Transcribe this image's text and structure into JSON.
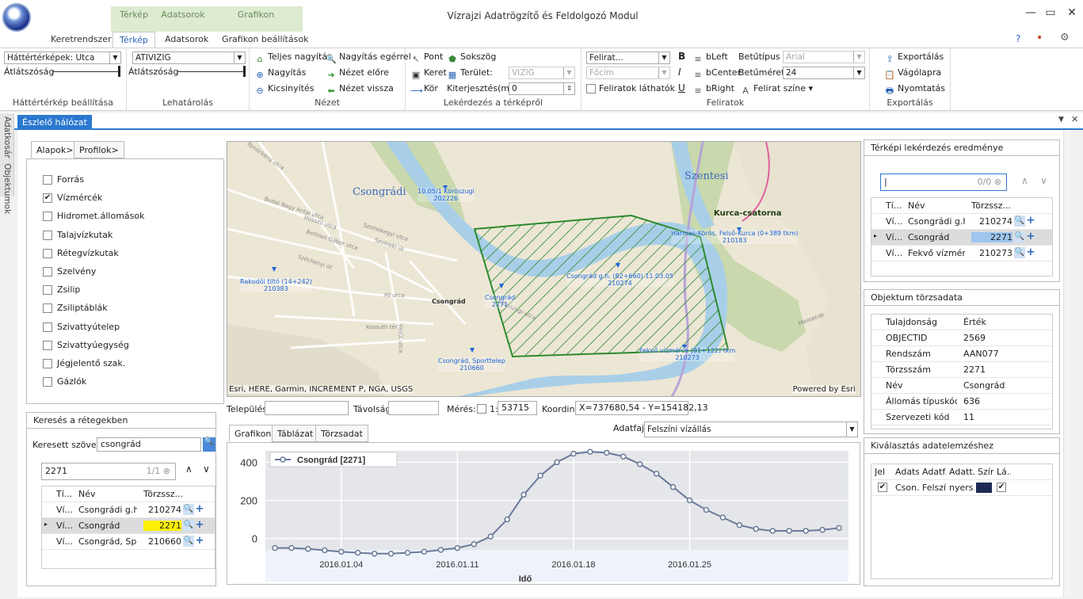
{
  "app": {
    "title": "Vízrajzi Adatrögzítő és Feldolgozó Modul",
    "context_tabs": [
      "Térkép",
      "Adatsorok",
      "Grafikon"
    ],
    "tabs": [
      "Keretrendszer",
      "Térkép",
      "Adatsorok",
      "Grafikon beállítások"
    ],
    "active_tab": "Térkép"
  },
  "window": {
    "minimize": "—",
    "maximize": "▭",
    "close": "✕",
    "help": "?",
    "user": "•",
    "settings": "⚙"
  },
  "ribbon": {
    "basemap": {
      "combo": "Háttértérképek: Utca",
      "opacity_label": "Átlátszóság",
      "group": "Háttértérkép beállítása"
    },
    "access": {
      "combo": "ATIVIZIG",
      "opacity_label": "Átlátszóság",
      "group": "Lehatárolás"
    },
    "view": {
      "full": "Teljes nagyítás",
      "zoom_mouse": "Nagyítás egérrel",
      "zoom_in": "Nagyítás",
      "prev": "Nézet előre",
      "zoom_out": "Kicsinyítés",
      "back": "Nézet vissza",
      "group": "Nézet"
    },
    "query": {
      "point": "Pont",
      "polygon": "Sokszög",
      "frame": "Keret",
      "area": "Terület:",
      "area_combo": "VIZIG",
      "circle": "Kör",
      "extent_label": "Kiterjesztés(m):",
      "extent_value": "0",
      "group": "Lekérdezés a térképről"
    },
    "labels": {
      "combo1": "Felirat...",
      "combo2": "Főcím",
      "visible": "Feliratok láthatók",
      "bleft": "bLeft",
      "bcenter": "bCenter",
      "bright": "bRight",
      "font_label": "Betűtípus",
      "font_value": "Arial",
      "size_label": "Betűméret",
      "size_value": "24",
      "color_label": "Felirat színe",
      "bold": "B",
      "italic": "I",
      "underline": "U",
      "group": "Feliratok"
    },
    "export": {
      "export": "Exportálás",
      "clipboard": "Vágólapra",
      "print": "Nyomtatás",
      "group": "Exportálás"
    }
  },
  "sidebar": {
    "items": [
      "Adatkosár",
      "Objektumok"
    ]
  },
  "doc_tab": "Észlelő hálózat",
  "left_panel": {
    "tabs": [
      "Alapok>",
      "Profilok>"
    ],
    "layers": [
      {
        "label": "Forrás",
        "checked": false
      },
      {
        "label": "Vízmércék",
        "checked": true
      },
      {
        "label": "Hidromet.állomások",
        "checked": false
      },
      {
        "label": "Talajvízkutak",
        "checked": false
      },
      {
        "label": "Rétegvízkutak",
        "checked": false
      },
      {
        "label": "Szelvény",
        "checked": false
      },
      {
        "label": "Zsilip",
        "checked": false
      },
      {
        "label": "Zsiliptáblák",
        "checked": false
      },
      {
        "label": "Szivattyútelep",
        "checked": false
      },
      {
        "label": "Szivattyúegység",
        "checked": false
      },
      {
        "label": "Jégjelentő szak.",
        "checked": false
      },
      {
        "label": "Gázlók",
        "checked": false
      }
    ]
  },
  "search": {
    "title": "Keresés a rétegekben",
    "label": "Keresett szöveg:",
    "value": "csongrád",
    "filter": "2271",
    "count": "1/1",
    "columns": [
      "Tí...",
      "Név",
      "Törzssz..."
    ],
    "rows": [
      {
        "type": "Ví...",
        "name": "Csongrádi g.h...",
        "id": "210274"
      },
      {
        "type": "Ví...",
        "name": "Csongrád",
        "id": "2271"
      },
      {
        "type": "Ví...",
        "name": "Csongrád, Sp...",
        "id": "210660"
      }
    ]
  },
  "map": {
    "attribution": "Esri, HERE, Garmin, INCREMENT P, NGA, USGS",
    "powered": "Powered by Esri",
    "place_labels": [
      "Csongrádi",
      "Szentesi",
      "Kurca-csatorna",
      "Csongrád"
    ],
    "stations": [
      {
        "text": "10.05/1 Köröszugi\n202226"
      },
      {
        "text": "Hármas-Körös, Felső-Kurca (0+389 tkm)\n210183"
      },
      {
        "text": "Rakodói tiltó (14+242)\n210383"
      },
      {
        "text": "Csongrád g.h. (82+660) 11.03.05\n210274"
      },
      {
        "text": "Csongrád\n2271"
      },
      {
        "text": "Csongrád, Sporttelep\n210660"
      },
      {
        "text": "Fekvő vízmérce (81+122) tkm\n210273"
      }
    ],
    "streets": [
      "Tömörkény utca",
      "Budai Nagy Antal utca",
      "Hosszú utca",
      "Bethlen Gábor utca",
      "Szolnoki út",
      "Szolnokegyi utca",
      "Fő utca",
      "Széchenyi út",
      "Köröszugi utca",
      "Kossuth tér",
      "Vasút utca",
      "Mentetrét"
    ]
  },
  "map_toolbar": {
    "settlement_label": "Település:",
    "distance_label": "Távolság:",
    "scale_label": "Mérés:",
    "scale_prefix": "1:",
    "scale_value": "53715",
    "coord_label": "Koordináták",
    "coord_value": "X=737680,54 - Y=154182,13"
  },
  "chart_panel": {
    "tabs": [
      "Grafikon",
      "Táblázat",
      "Törzsadat"
    ],
    "data_type_label": "Adatfajta",
    "data_type_value": "Felszíni vízállás"
  },
  "chart_data": {
    "type": "line",
    "xlabel": "Idő",
    "ylabel": "",
    "ylim": [
      -60,
      460
    ],
    "y_ticks": [
      0,
      200,
      400
    ],
    "x_ticks": [
      "2016.01.04",
      "2016.01.11",
      "2016.01.18",
      "2016.01.25"
    ],
    "series": [
      {
        "name": "Csongrád [2271]",
        "color": "#6a7a98",
        "values": [
          -50,
          -50,
          -55,
          -62,
          -70,
          -75,
          -80,
          -80,
          -75,
          -70,
          -60,
          -50,
          -30,
          10,
          100,
          230,
          330,
          400,
          445,
          455,
          450,
          430,
          390,
          340,
          270,
          200,
          150,
          110,
          70,
          50,
          40,
          40,
          40,
          45,
          55
        ]
      }
    ]
  },
  "query_results": {
    "title": "Térképi lekérdezés eredménye",
    "count": "0/0",
    "columns": [
      "Tí...",
      "Név",
      "Törzssz..."
    ],
    "rows": [
      {
        "type": "Ví...",
        "name": "Csongrádi g.h...",
        "id": "210274"
      },
      {
        "type": "Ví...",
        "name": "Csongrád",
        "id": "2271"
      },
      {
        "type": "Ví...",
        "name": "Fekvő vízmérc...",
        "id": "210273"
      }
    ]
  },
  "master_data": {
    "title": "Objektum törzsadata",
    "columns": [
      "Tulajdonság",
      "Érték"
    ],
    "rows": [
      {
        "k": "OBJECTID",
        "v": "2569"
      },
      {
        "k": "Rendszám",
        "v": "AAN077"
      },
      {
        "k": "Törzsszám",
        "v": "2271"
      },
      {
        "k": "Név",
        "v": "Csongrád"
      },
      {
        "k": "Állomás típuskód",
        "v": "636"
      },
      {
        "k": "Szervezeti kód",
        "v": "11"
      }
    ]
  },
  "display_select": {
    "title": "Kiválasztás adatelemzéshez",
    "columns": [
      "Jel",
      "Adats...",
      "Adatf...",
      "Adatt...",
      "Szín",
      "Lá..."
    ],
    "rows": [
      {
        "jel": true,
        "adats": "Cson...",
        "adatf": "Felszí...",
        "adatt": "nyers...",
        "color": "#1c2a55",
        "visible": true
      }
    ]
  }
}
